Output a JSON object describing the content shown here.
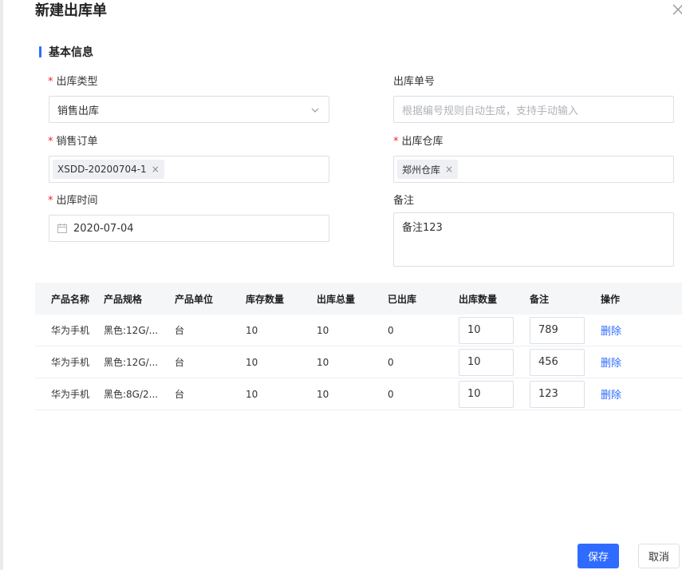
{
  "dialog": {
    "title": "新建出库单"
  },
  "section": {
    "title": "基本信息"
  },
  "form": {
    "type_label": "出库类型",
    "type_value": "销售出库",
    "number_label": "出库单号",
    "number_placeholder": "根据编号规则自动生成，支持手动输入",
    "order_label": "销售订单",
    "order_tag": "XSDD-20200704-1",
    "warehouse_label": "出库仓库",
    "warehouse_tag": "郑州仓库",
    "time_label": "出库时间",
    "time_value": "2020-07-04",
    "remark_label": "备注",
    "remark_value": "备注123",
    "required_mark": "*"
  },
  "table": {
    "headers": [
      "产品名称",
      "产品规格",
      "产品单位",
      "库存数量",
      "出库总量",
      "已出库",
      "出库数量",
      "备注",
      "操作"
    ],
    "rows": [
      {
        "name": "华为手机",
        "spec": "黑色:12G/...",
        "unit": "台",
        "stock": "10",
        "total": "10",
        "out": "0",
        "qty": "10",
        "remark": "789",
        "action": "删除"
      },
      {
        "name": "华为手机",
        "spec": "黑色:12G/...",
        "unit": "台",
        "stock": "10",
        "total": "10",
        "out": "0",
        "qty": "10",
        "remark": "456",
        "action": "删除"
      },
      {
        "name": "华为手机",
        "spec": "黑色:8G/2...",
        "unit": "台",
        "stock": "10",
        "total": "10",
        "out": "0",
        "qty": "10",
        "remark": "123",
        "action": "删除"
      }
    ]
  },
  "footer": {
    "save_label": "保存",
    "cancel_label": "取消"
  },
  "colors": {
    "primary": "#2f6bff",
    "required": "#f5222d",
    "header_bg": "#f5f6f8"
  },
  "icons": [
    "close-icon",
    "chevron-down-icon",
    "calendar-icon",
    "tag-close-icon"
  ]
}
